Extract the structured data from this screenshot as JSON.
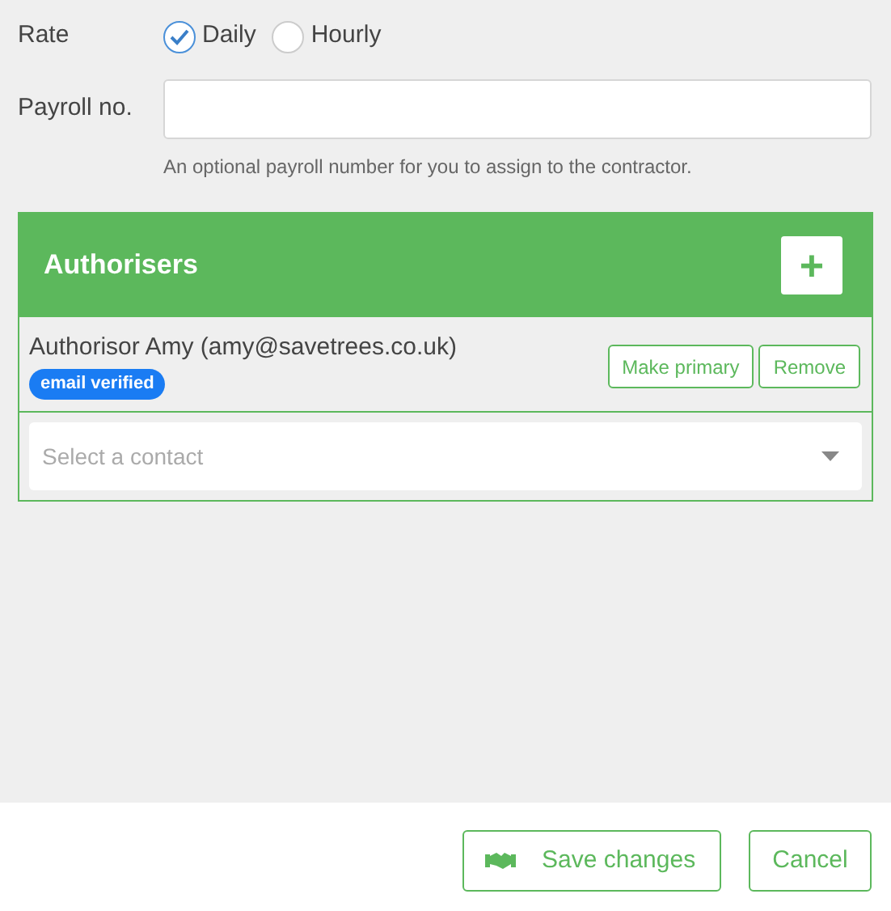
{
  "rate": {
    "label": "Rate",
    "options": [
      {
        "label": "Daily",
        "selected": true
      },
      {
        "label": "Hourly",
        "selected": false
      }
    ]
  },
  "payroll": {
    "label": "Payroll no.",
    "hint": "An optional payroll number for you to assign to the contractor."
  },
  "authorisers": {
    "title": "Authorisers",
    "add_button": "+",
    "items": [
      {
        "name": "Authorisor Amy (amy@savetrees.co.uk)",
        "badge": "email verified",
        "actions": [
          "Make primary",
          "Remove"
        ]
      }
    ],
    "select": {
      "placeholder": "Select a contact"
    }
  },
  "footer": {
    "buttons": [
      {
        "label": "Save changes",
        "kind": "save"
      },
      {
        "label": "Cancel",
        "kind": "cancel"
      }
    ]
  }
}
